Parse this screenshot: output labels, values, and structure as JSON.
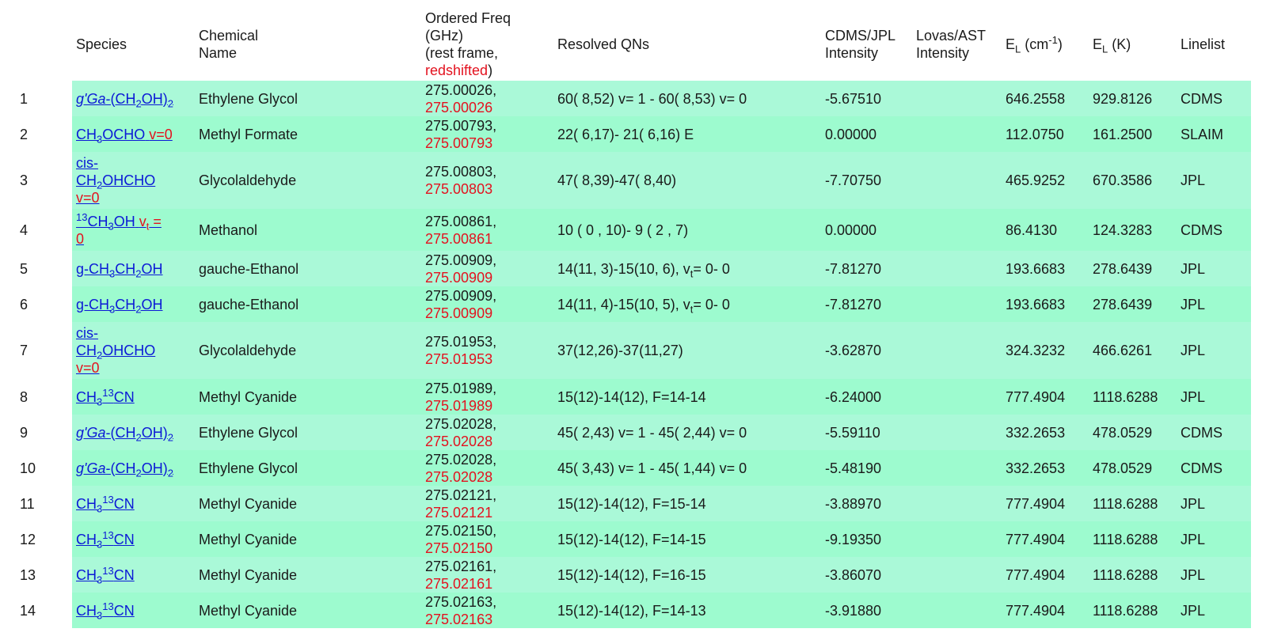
{
  "headers": {
    "species": "Species",
    "chem_name_1": "Chemical",
    "chem_name_2": "Name",
    "freq_1": "Ordered Freq",
    "freq_2": "(GHz)",
    "freq_3": "(rest frame,",
    "freq_4": "redshifted",
    "freq_5": ")",
    "qns": "Resolved QNs",
    "cdms_1": "CDMS/JPL",
    "cdms_2": "Intensity",
    "lovas_1": "Lovas/AST",
    "lovas_2": "Intensity",
    "el_cm": "(cm",
    "el_cm_sup": "-1",
    "el_cm_end": ")",
    "el_k": "(K)",
    "e_letter": "E",
    "l_sub": "L",
    "linelist": "Linelist"
  },
  "rows": [
    {
      "num": "1",
      "name": "Ethylene Glycol",
      "rest": "275.00026,",
      "red": "275.00026",
      "qn": "60( 8,52) v= 1 - 60( 8,53) v= 0",
      "cdms": "-5.67510",
      "lovas": "",
      "elcm": "646.2558",
      "elk": "929.8126",
      "list": "CDMS"
    },
    {
      "num": "2",
      "name": "Methyl Formate",
      "rest": "275.00793,",
      "red": "275.00793",
      "qn": "22( 6,17)- 21( 6,16) E",
      "cdms": "0.00000",
      "lovas": "",
      "elcm": "112.0750",
      "elk": "161.2500",
      "list": "SLAIM"
    },
    {
      "num": "3",
      "name": "Glycolaldehyde",
      "rest": "275.00803,",
      "red": "275.00803",
      "qn": "47( 8,39)-47( 8,40)",
      "cdms": "-7.70750",
      "lovas": "",
      "elcm": "465.9252",
      "elk": "670.3586",
      "list": "JPL"
    },
    {
      "num": "4",
      "name": "Methanol",
      "rest": "275.00861,",
      "red": "275.00861",
      "qn": "10 ( 0 , 10)- 9 ( 2 , 7)",
      "cdms": "0.00000",
      "lovas": "",
      "elcm": "86.4130",
      "elk": "124.3283",
      "list": "CDMS"
    },
    {
      "num": "5",
      "name": "gauche-Ethanol",
      "rest": "275.00909,",
      "red": "275.00909",
      "qn_a": "14(11, 3)-15(10, 6), v",
      "qn_sub": "t",
      "qn_b": "= 0- 0",
      "cdms": "-7.81270",
      "lovas": "",
      "elcm": "193.6683",
      "elk": "278.6439",
      "list": "JPL"
    },
    {
      "num": "6",
      "name": "gauche-Ethanol",
      "rest": "275.00909,",
      "red": "275.00909",
      "qn_a": "14(11, 4)-15(10, 5), v",
      "qn_sub": "t",
      "qn_b": "= 0- 0",
      "cdms": "-7.81270",
      "lovas": "",
      "elcm": "193.6683",
      "elk": "278.6439",
      "list": "JPL"
    },
    {
      "num": "7",
      "name": "Glycolaldehyde",
      "rest": "275.01953,",
      "red": "275.01953",
      "qn": "37(12,26)-37(11,27)",
      "cdms": "-3.62870",
      "lovas": "",
      "elcm": "324.3232",
      "elk": "466.6261",
      "list": "JPL"
    },
    {
      "num": "8",
      "name": "Methyl Cyanide",
      "rest": "275.01989,",
      "red": "275.01989",
      "qn": "15(12)-14(12), F=14-14",
      "cdms": "-6.24000",
      "lovas": "",
      "elcm": "777.4904",
      "elk": "1118.6288",
      "list": "JPL"
    },
    {
      "num": "9",
      "name": "Ethylene Glycol",
      "rest": "275.02028,",
      "red": "275.02028",
      "qn": "45( 2,43) v= 1 - 45( 2,44) v= 0",
      "cdms": "-5.59110",
      "lovas": "",
      "elcm": "332.2653",
      "elk": "478.0529",
      "list": "CDMS"
    },
    {
      "num": "10",
      "name": "Ethylene Glycol",
      "rest": "275.02028,",
      "red": "275.02028",
      "qn": "45( 3,43) v= 1 - 45( 1,44) v= 0",
      "cdms": "-5.48190",
      "lovas": "",
      "elcm": "332.2653",
      "elk": "478.0529",
      "list": "CDMS"
    },
    {
      "num": "11",
      "name": "Methyl Cyanide",
      "rest": "275.02121,",
      "red": "275.02121",
      "qn": "15(12)-14(12), F=15-14",
      "cdms": "-3.88970",
      "lovas": "",
      "elcm": "777.4904",
      "elk": "1118.6288",
      "list": "JPL"
    },
    {
      "num": "12",
      "name": "Methyl Cyanide",
      "rest": "275.02150,",
      "red": "275.02150",
      "qn": "15(12)-14(12), F=14-15",
      "cdms": "-9.19350",
      "lovas": "",
      "elcm": "777.4904",
      "elk": "1118.6288",
      "list": "JPL"
    },
    {
      "num": "13",
      "name": "Methyl Cyanide",
      "rest": "275.02161,",
      "red": "275.02161",
      "qn": "15(12)-14(12), F=16-15",
      "cdms": "-3.86070",
      "lovas": "",
      "elcm": "777.4904",
      "elk": "1118.6288",
      "list": "JPL"
    },
    {
      "num": "14",
      "name": "Methyl Cyanide",
      "rest": "275.02163,",
      "red": "275.02163",
      "qn": "15(12)-14(12), F=14-13",
      "cdms": "-3.91880",
      "lovas": "",
      "elcm": "777.4904",
      "elk": "1118.6288",
      "list": "JPL"
    }
  ],
  "species": {
    "eg": {
      "prefix": "g'Ga",
      "a": "-(CH",
      "b": "OH)",
      "s1": "2",
      "s2": "2"
    },
    "mf": {
      "a": "CH",
      "s": "3",
      "b": "OCHO",
      "v": "v=0"
    },
    "ga": {
      "l1": "cis-",
      "a": "CH",
      "s": "2",
      "b": "OHCHO",
      "v": "v=0"
    },
    "me": {
      "sup": "13",
      "a": "CH",
      "s": "3",
      "b": "OH",
      "v1": "v",
      "vsub": "t",
      "v2": " =",
      "v3": "0"
    },
    "et": {
      "a": "g-CH",
      "s1": "3",
      "b": "CH",
      "s2": "2",
      "c": "OH"
    },
    "mc": {
      "a": "CH",
      "s": "3",
      "sup": "13",
      "b": "CN"
    }
  }
}
